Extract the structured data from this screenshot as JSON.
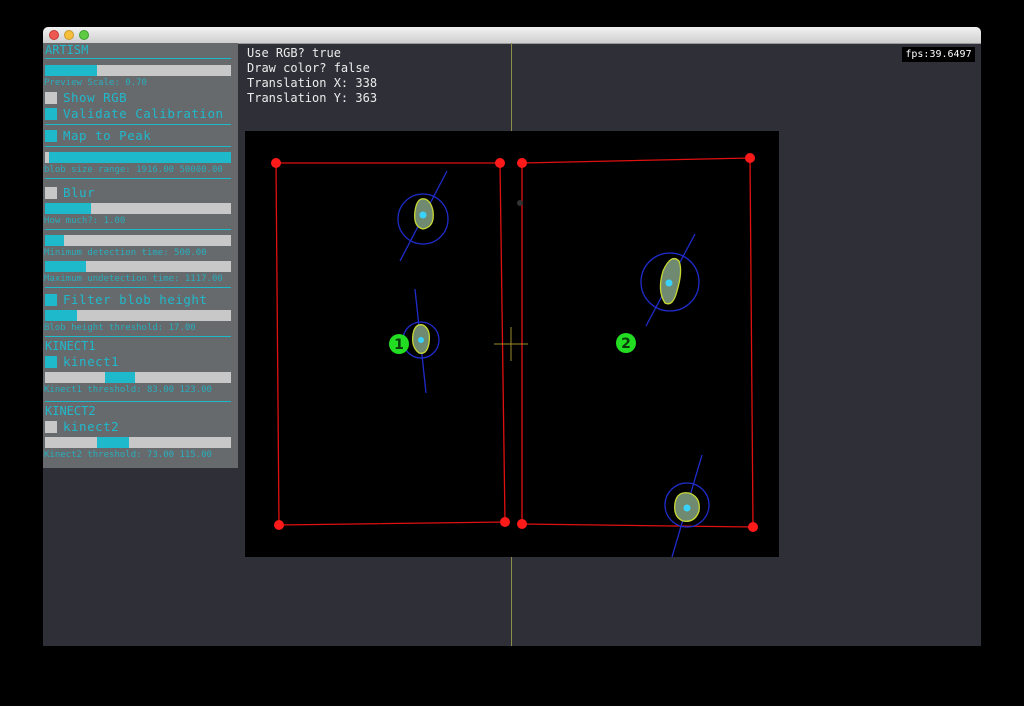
{
  "panel": {
    "artism_header": "ARTISM",
    "preview_scale_label": "Preview Scale: 0.70",
    "preview_scale_value": 0.7,
    "show_rgb": {
      "label": "Show RGB",
      "checked": false
    },
    "validate_calibration": {
      "label": "Validate Calibration",
      "checked": true
    },
    "map_to_peak": {
      "label": "Map to Peak",
      "checked": true
    },
    "blob_size_label": "blob size range: 1916.00 50000.00",
    "blob_size_range": [
      1916.0,
      50000.0
    ],
    "blur": {
      "label": "Blur",
      "checked": false
    },
    "how_much_label": "How much?: 1.00",
    "how_much": 1.0,
    "min_detection_label": "Minimum detection time: 500.00",
    "min_detection": 500.0,
    "max_undetection_label": "Maximum undetection time: 1117.00",
    "max_undetection": 1117.0,
    "filter_blob_height": {
      "label": "Filter blob height",
      "checked": true
    },
    "blob_height_label": "Blob height threshold: 17.00",
    "blob_height": 17.0,
    "kinect1_header": "KINECT1",
    "kinect1": {
      "label": "kinect1",
      "checked": true
    },
    "kinect1_threshold_label": "Kinect1 threshold: 83.00 123.00",
    "kinect1_threshold": [
      83.0,
      123.0
    ],
    "kinect2_header": "KINECT2",
    "kinect2": {
      "label": "kinect2",
      "checked": false
    },
    "kinect2_threshold_label": "Kinect2 threshold: 73.00 115.00",
    "kinect2_threshold": [
      73.0,
      115.0
    ]
  },
  "info": {
    "use_rgb": "Use RGB? true",
    "draw_color": "Draw color? false",
    "translation_x": "Translation X: 338",
    "translation_y": "Translation Y: 363"
  },
  "fps": "fps:39.6497",
  "view": {
    "zone_labels": [
      "1",
      "2"
    ],
    "colors": {
      "boundary": "#e01010",
      "handle": "#ff1a1a",
      "zone_badge": "#22dd22",
      "blob_circle": "#1f2ccc",
      "blob_outline": "#c8d832",
      "crosshair": "#9a8a2a"
    }
  },
  "colors": {
    "accent": "#1fb9cc",
    "panel_bg": "#666a6c",
    "window_bg": "#2f2f38"
  }
}
